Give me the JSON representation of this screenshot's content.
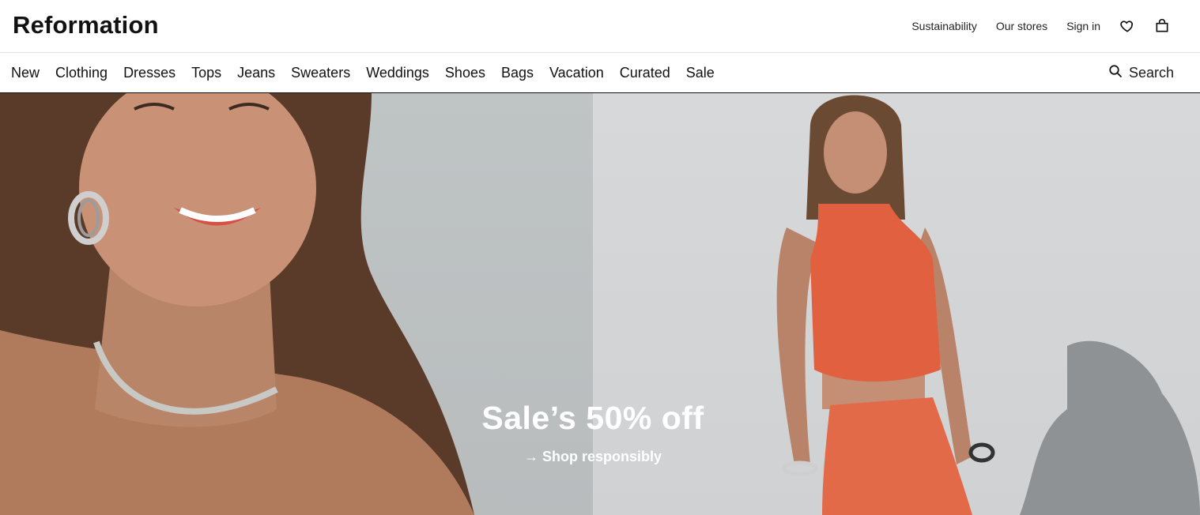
{
  "brand": {
    "logo": "Reformation"
  },
  "utility_nav": {
    "sustainability": "Sustainability",
    "stores": "Our stores",
    "sign_in": "Sign in",
    "wishlist_icon": "heart-icon",
    "bag_icon": "bag-icon"
  },
  "main_nav": {
    "items": [
      "New",
      "Clothing",
      "Dresses",
      "Tops",
      "Jeans",
      "Sweaters",
      "Weddings",
      "Shoes",
      "Bags",
      "Vacation",
      "Curated",
      "Sale"
    ],
    "search_label": "Search",
    "search_icon": "search-icon"
  },
  "hero": {
    "headline": "Sale’s 50% off",
    "cta": "→ Shop responsibly",
    "colors": {
      "left_bg": "#bfc4c5",
      "right_bg": "#d6d8da",
      "outfit": "#e0603f"
    }
  }
}
